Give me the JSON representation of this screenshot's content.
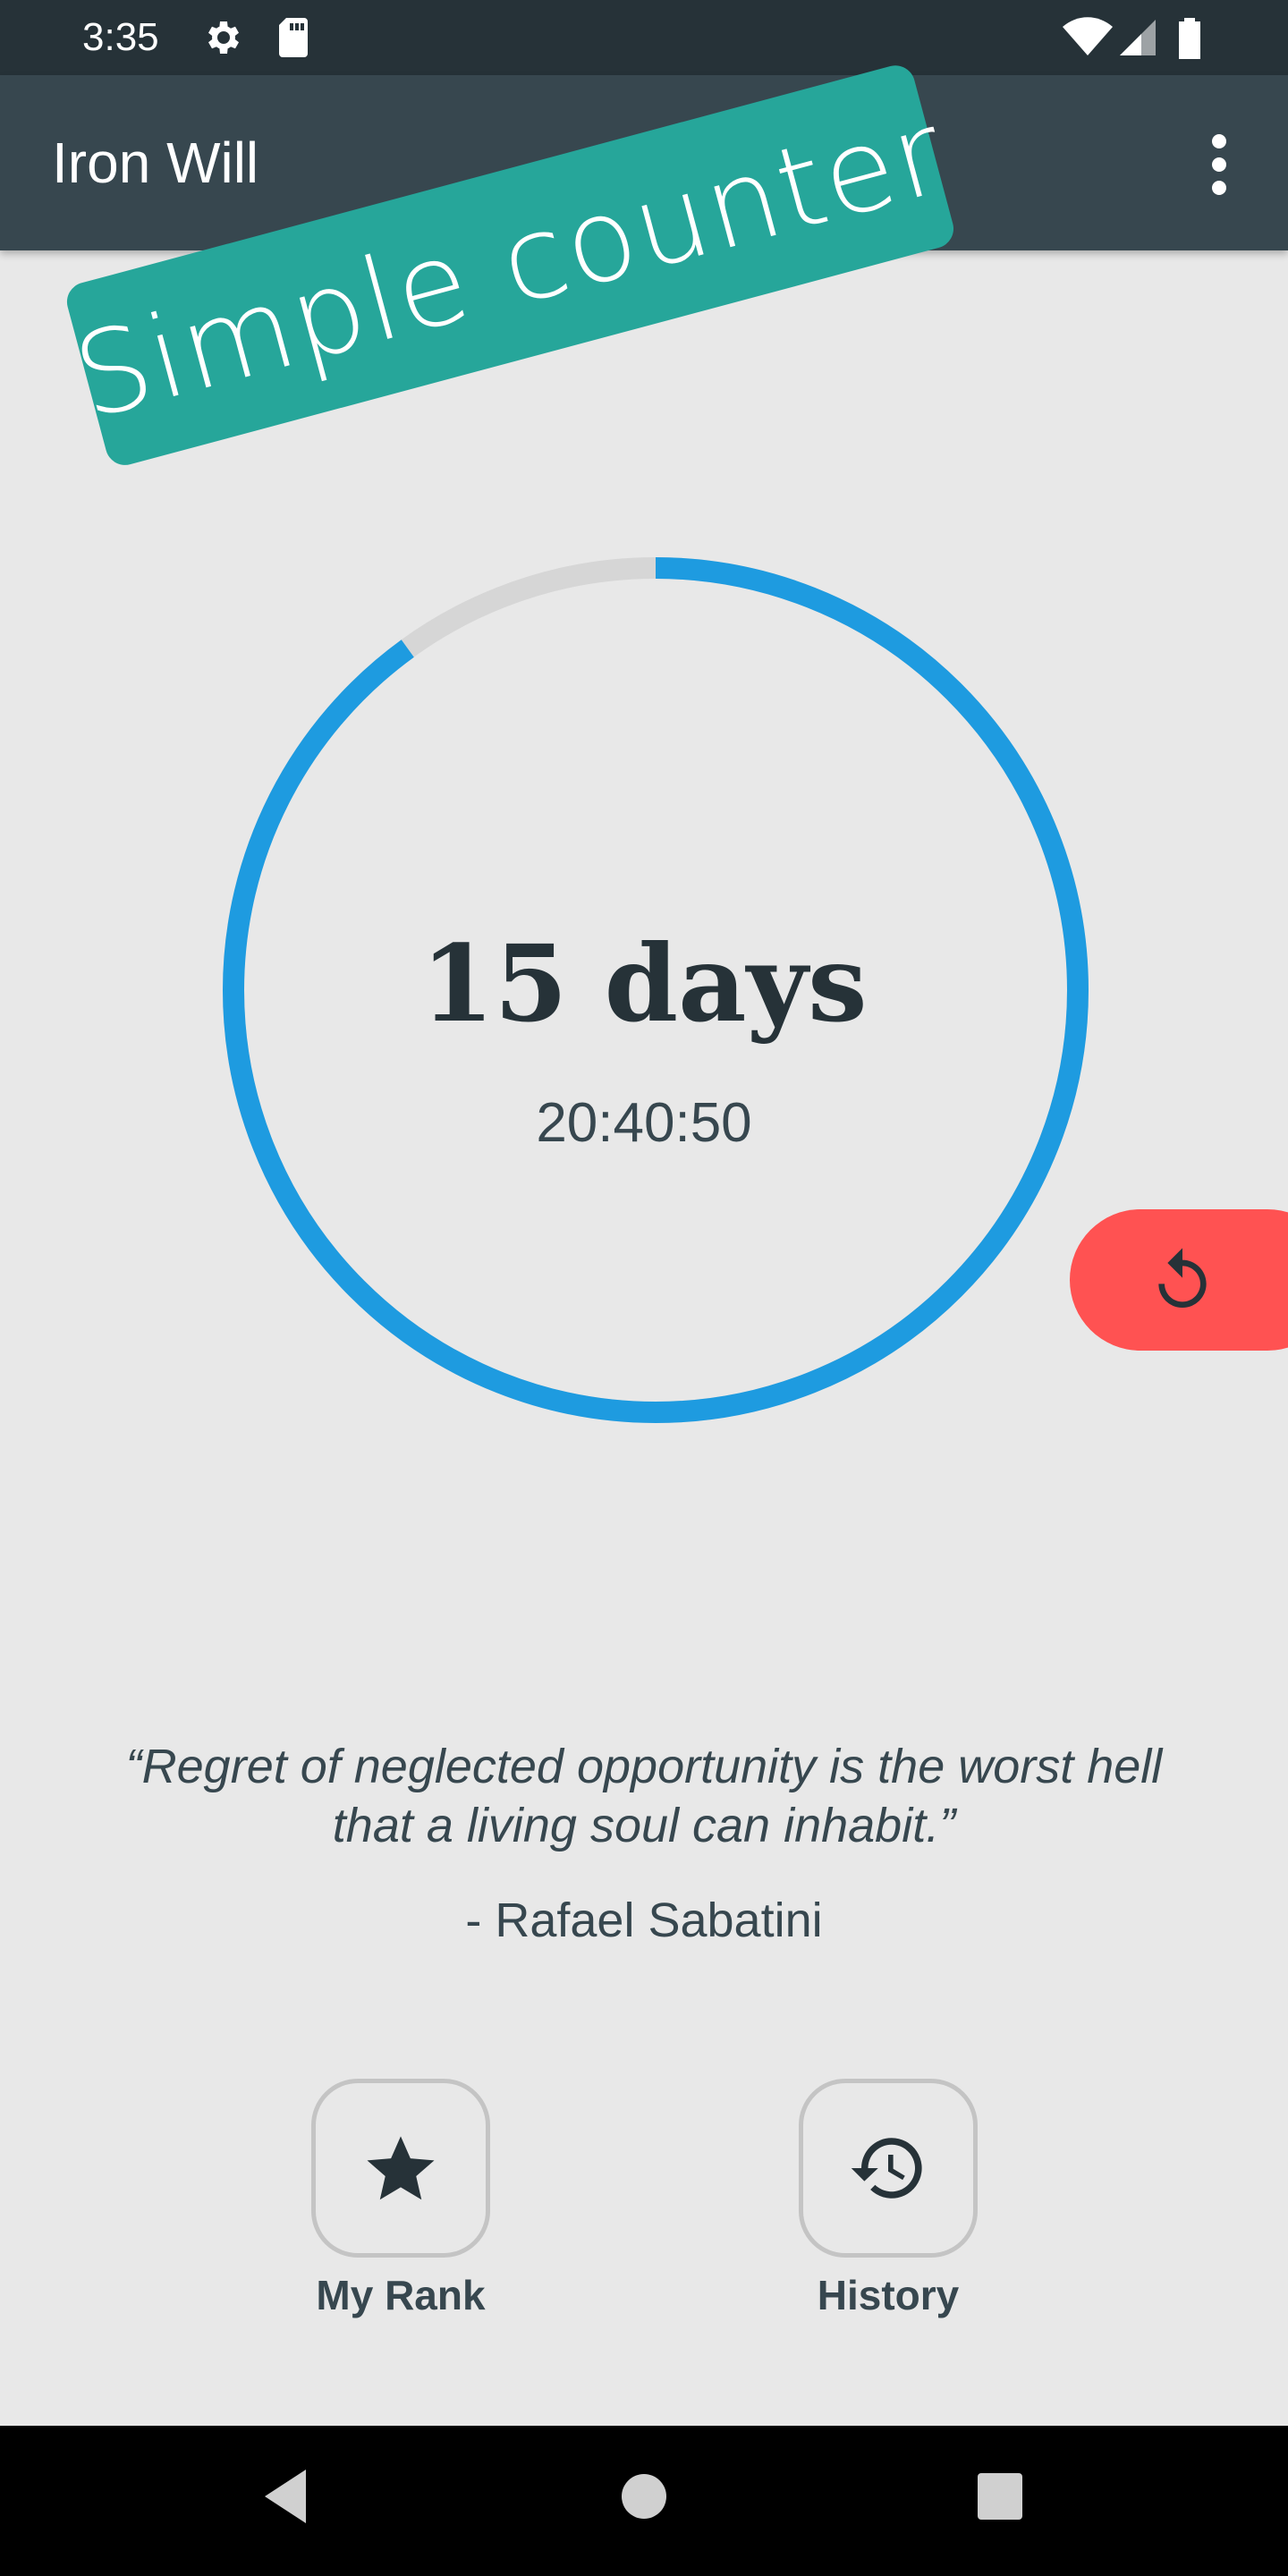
{
  "status_bar": {
    "time": "3:35",
    "icons": [
      "gear-icon",
      "sd-card-icon",
      "wifi-icon",
      "signal-icon",
      "battery-icon"
    ]
  },
  "app_bar": {
    "title": "Iron Will",
    "menu_icon": "more-vert-icon"
  },
  "badge": {
    "label": "Simple counter"
  },
  "counter": {
    "progress": 0.9,
    "days": "15 days",
    "time": "20:40:50"
  },
  "reset_button": {
    "icon": "reset-icon"
  },
  "quote": {
    "text": "“Regret of neglected opportunity is the worst hell that a living soul can inhabit.”",
    "author": "- Rafael Sabatini"
  },
  "actions": {
    "rank_label": "My Rank",
    "rank_icon": "star-icon",
    "history_label": "History",
    "history_icon": "history-icon"
  },
  "system_nav": {
    "back_icon": "back-icon",
    "home_icon": "home-icon",
    "recents_icon": "recents-icon"
  },
  "colors": {
    "status_bar": "#263238",
    "app_bar": "#37474f",
    "background": "#e8e8e8",
    "badge": "#26a69a",
    "progress": "#1e9be0",
    "track": "#d6d6d6",
    "reset": "#ff5252"
  }
}
